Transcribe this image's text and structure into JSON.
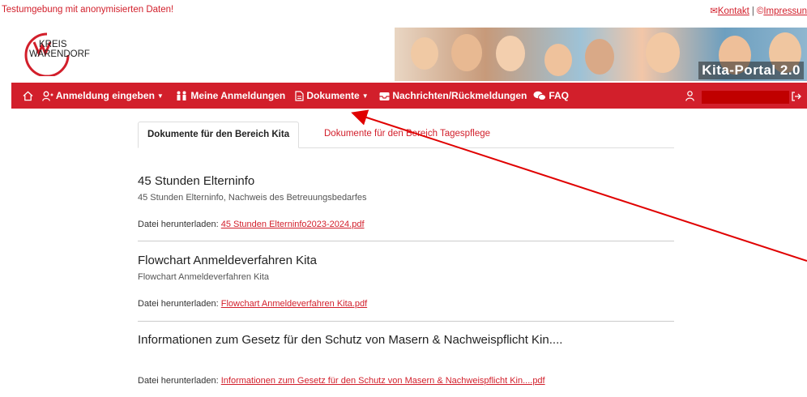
{
  "top": {
    "notice": "Testumgebung mit anonymisierten Daten!",
    "contact": "Kontakt",
    "separator": "|",
    "impressum": "Impressun"
  },
  "logo": {
    "line1": "KREIS",
    "line2": "WARENDORF"
  },
  "banner": {
    "title": "Kita-Portal 2.0"
  },
  "nav": {
    "anmeldung": "Anmeldung eingeben",
    "meine": "Meine Anmeldungen",
    "dokumente": "Dokumente",
    "nachrichten": "Nachrichten/Rückmeldungen",
    "faq": "FAQ"
  },
  "tabs": {
    "active": "Dokumente für den Bereich Kita",
    "inactive": "Dokumente für den Bereich Tagespflege"
  },
  "documents": [
    {
      "title": "45 Stunden Elterninfo",
      "description": "45 Stunden Elterninfo, Nachweis des Betreuungsbedarfes",
      "download_label": "Datei herunterladen:",
      "file": "45 Stunden Elterninfo2023-2024.pdf"
    },
    {
      "title": "Flowchart Anmeldeverfahren Kita",
      "description": "Flowchart Anmeldeverfahren Kita",
      "download_label": "Datei herunterladen:",
      "file": "Flowchart Anmeldeverfahren Kita.pdf"
    },
    {
      "title": "Informationen zum Gesetz für den Schutz von Masern & Nachweispflicht Kin....",
      "description": "",
      "download_label": "Datei herunterladen:",
      "file": "Informationen zum Gesetz für den Schutz von Masern & Nachweispflicht Kin....pdf"
    }
  ],
  "colors": {
    "brand": "#d21f2b",
    "annotation_arrow": "#e00000"
  }
}
